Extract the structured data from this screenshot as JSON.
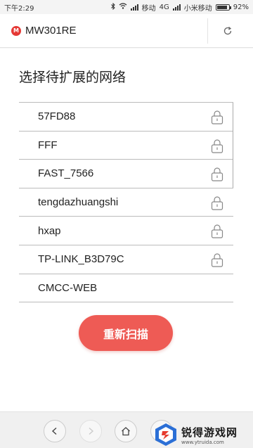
{
  "status_bar": {
    "time": "下午2:29",
    "network_type": "4G",
    "carrier_1": "移动",
    "carrier_2": "小米移动",
    "battery": "92%",
    "battery_level": 0.92
  },
  "browser": {
    "url": "MW301RE",
    "site_logo": "M"
  },
  "page": {
    "title": "选择待扩展的网络",
    "networks": [
      {
        "ssid": "57FD88",
        "locked": true
      },
      {
        "ssid": "FFF",
        "locked": true
      },
      {
        "ssid": "FAST_7566",
        "locked": true
      },
      {
        "ssid": "tengdazhuangshi",
        "locked": true
      },
      {
        "ssid": "hxap",
        "locked": true
      },
      {
        "ssid": "TP-LINK_B3D79C",
        "locked": true
      },
      {
        "ssid": "CMCC-WEB",
        "locked": false
      }
    ],
    "rescan_label": "重新扫描"
  },
  "watermark": {
    "title": "锐得游戏网",
    "url": "www.ytruida.com"
  },
  "colors": {
    "accent": "#ee5b55",
    "logo_red": "#e53935"
  }
}
